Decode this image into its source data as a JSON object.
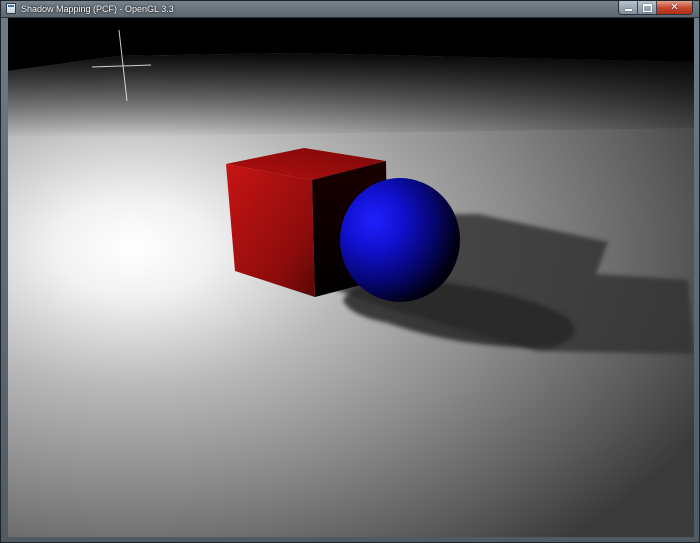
{
  "window": {
    "title": "Shadow Mapping (PCF) - OpenGL 3.3",
    "app_icon": "opengl-window-icon",
    "controls": {
      "minimize_icon": "minimize-icon",
      "maximize_icon": "maximize-icon",
      "close_icon": "close-icon"
    }
  },
  "scene": {
    "objects": [
      {
        "name": "cube",
        "color": "#c01010"
      },
      {
        "name": "sphere",
        "color": "#1010e0"
      }
    ],
    "floor_color": "#cfcfcf",
    "background_color": "#000000",
    "cursor_icon": "crosshair-icon"
  }
}
